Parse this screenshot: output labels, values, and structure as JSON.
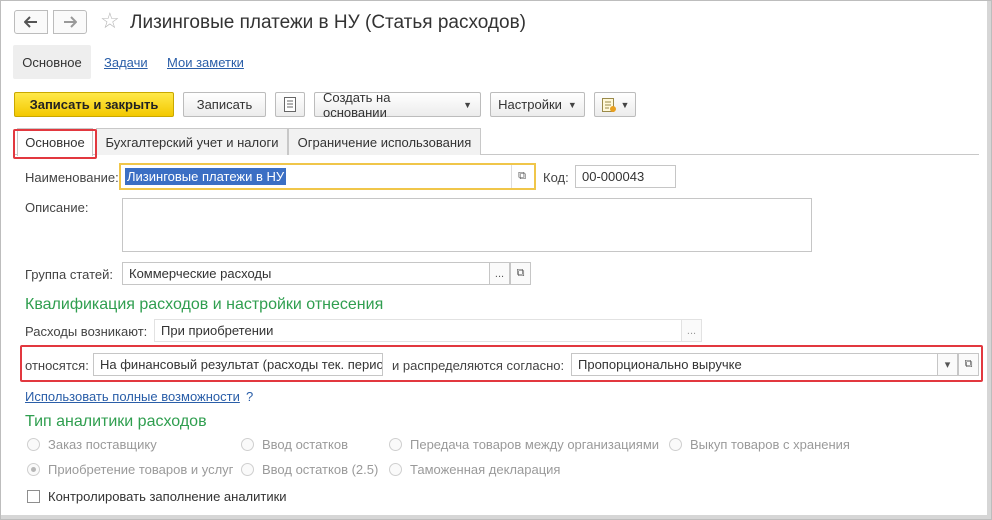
{
  "window": {
    "title": "Лизинговые платежи в НУ (Статья расходов)",
    "back_icon": "arrow-left-icon",
    "forward_icon": "arrow-right-icon",
    "favorite_icon": "star-icon"
  },
  "links": {
    "main": "Основное",
    "tasks": "Задачи",
    "notes": "Мои заметки"
  },
  "toolbar": {
    "save_close": "Записать и закрыть",
    "save": "Записать",
    "create_based": "Создать на основании",
    "settings": "Настройки"
  },
  "tabs": [
    {
      "label": "Основное",
      "active": true
    },
    {
      "label": "Бухгалтерский учет и налоги",
      "active": false
    },
    {
      "label": "Ограничение использования",
      "active": false
    }
  ],
  "form": {
    "name_label": "Наименование:",
    "name_value": "Лизинговые платежи в НУ",
    "code_label": "Код:",
    "code_value": "00-000043",
    "description_label": "Описание:",
    "description_value": "",
    "group_label": "Группа статей:",
    "group_value": "Коммерческие расходы",
    "choose_glyph": "..."
  },
  "qualification": {
    "title": "Квалификация расходов и настройки отнесения",
    "arise_label": "Расходы возникают:",
    "arise_value": "При приобретении",
    "relate_label": "относятся:",
    "relate_value": "На финансовый результат (расходы тек. перио,",
    "distribute_label": "и распределяются согласно:",
    "distribute_value": "Пропорционально выручке"
  },
  "full_features_link": "Использовать полные возможности",
  "help_mark": "?",
  "analytics": {
    "title": "Тип аналитики расходов",
    "options": [
      {
        "label": "Заказ поставщику",
        "selected": false
      },
      {
        "label": "Ввод остатков",
        "selected": false
      },
      {
        "label": "Передача товаров между организациями",
        "selected": false
      },
      {
        "label": "Выкуп товаров с хранения",
        "selected": false
      },
      {
        "label": "Приобретение товаров и услуг",
        "selected": true
      },
      {
        "label": "Ввод остатков (2.5)",
        "selected": false
      },
      {
        "label": "Таможенная декларация",
        "selected": false
      }
    ],
    "control_label": "Контролировать заполнение аналитики",
    "control_checked": false
  },
  "colors": {
    "accent_yellow": "#f3c800",
    "highlight_red": "#e2383f",
    "section_green": "#2f9e4f",
    "link_blue": "#2a5ea8"
  }
}
